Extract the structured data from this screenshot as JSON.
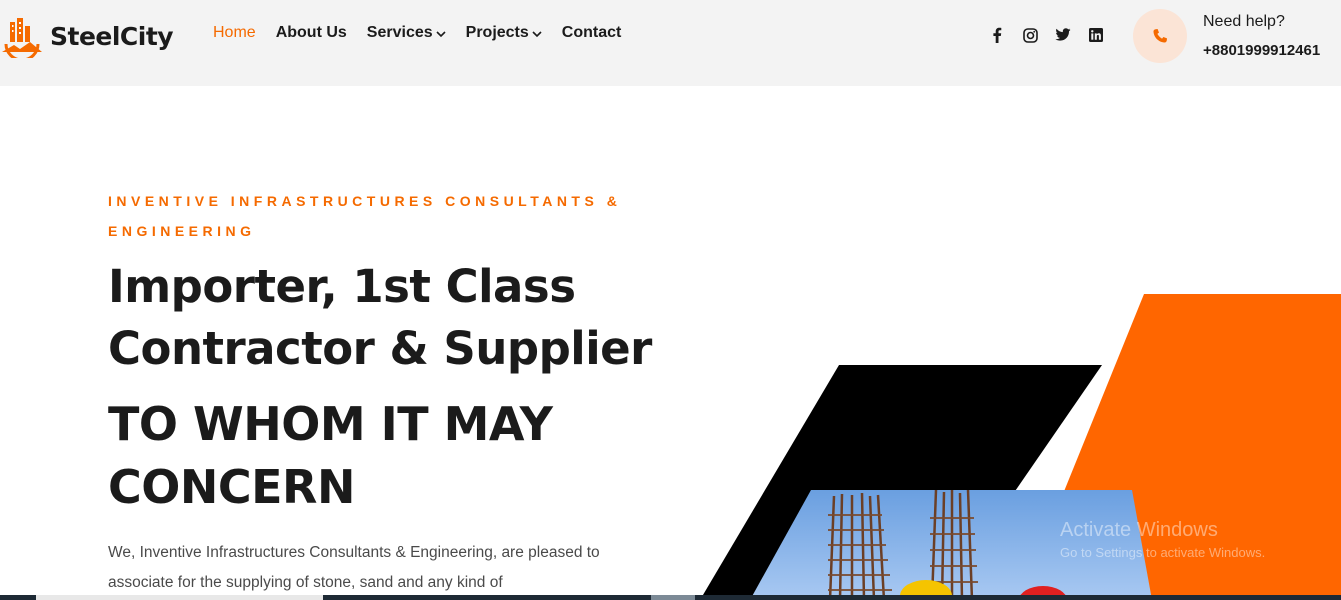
{
  "brand": {
    "name": "SteelCity",
    "accent": "#f56a00"
  },
  "nav": {
    "items": [
      {
        "label": "Home",
        "active": true,
        "dropdown": false
      },
      {
        "label": "About Us",
        "active": false,
        "dropdown": false
      },
      {
        "label": "Services",
        "active": false,
        "dropdown": true
      },
      {
        "label": "Projects",
        "active": false,
        "dropdown": true
      },
      {
        "label": "Contact",
        "active": false,
        "dropdown": false
      }
    ]
  },
  "social": [
    "facebook-icon",
    "instagram-icon",
    "twitter-icon",
    "linkedin-icon"
  ],
  "help": {
    "label": "Need help?",
    "phone": "+8801999912461",
    "icon": "phone-icon"
  },
  "hero": {
    "eyebrow": "INVENTIVE INFRASTRUCTURES CONSULTANTS & ENGINEERING",
    "title_line1": "Importer, 1st Class",
    "title_line2": "Contractor & Supplier",
    "subtitle_line1": "TO WHOM IT MAY",
    "subtitle_line2": "CONCERN",
    "body": "We, Inventive Infrastructures Consultants & Engineering, are pleased to associate for the supplying of stone, sand and any kind of"
  },
  "watermark": {
    "title": "Activate Windows",
    "subtitle": "Go to Settings to activate Windows."
  }
}
